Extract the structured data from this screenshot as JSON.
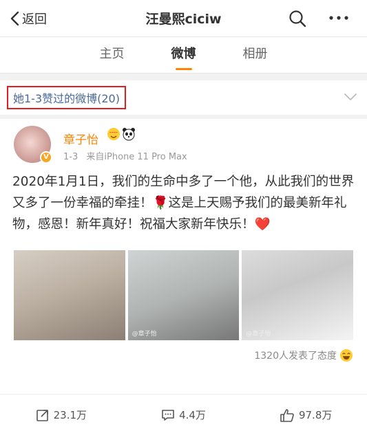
{
  "nav": {
    "back_label": "返回",
    "title": "汪曼熙ciciw",
    "icons": [
      "chevron-left-icon",
      "search-icon",
      "more-icon"
    ]
  },
  "tabs": [
    {
      "label": "主页",
      "active": false
    },
    {
      "label": "微博",
      "active": true
    },
    {
      "label": "相册",
      "active": false
    }
  ],
  "filter": {
    "label": "她1-3赞过的微博(20)"
  },
  "post": {
    "author": "章子怡",
    "author_emojis": [
      "heart-eyes-emoji",
      "panda-emoji"
    ],
    "date": "1-3",
    "source": "来自iPhone 11 Pro Max",
    "text": "2020年1月1日，我们的生命中多了一个他，从此我们的世界又多了一份幸福的牵挂！🌹这是上天赐予我们的最美新年礼物，感恩！新年真好！祝福大家新年快乐！❤️",
    "photo_watermarks": [
      "@章子怡",
      "@章子怡"
    ],
    "reactions": "1320人发表了态度",
    "reaction_emoji": "laughing-emoji",
    "reposts": "23.1万",
    "comments": "4.4万",
    "likes": "97.8万"
  },
  "colors": {
    "accent": "#ff8200",
    "highlight_border": "#e21d1d",
    "link": "#4a6a9a"
  }
}
